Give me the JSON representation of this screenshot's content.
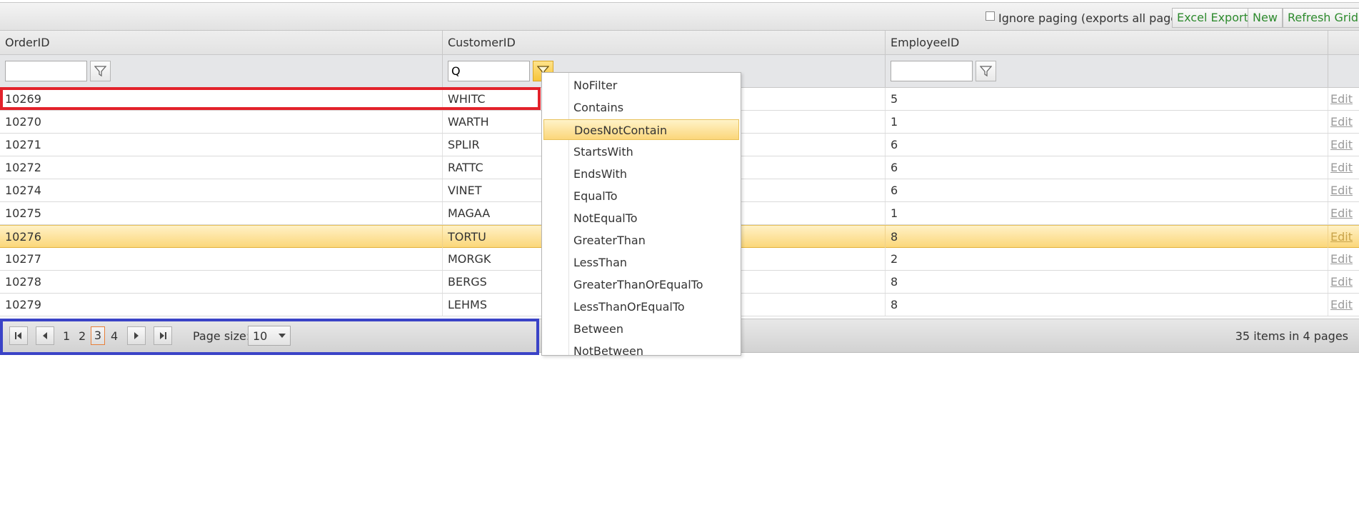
{
  "toolbar": {
    "ignore_paging_label": "Ignore paging (exports all pages)",
    "ignore_paging_checked": false,
    "excel_export": "Excel Export",
    "new": "New",
    "refresh_grid": "Refresh Grid",
    "button_text_color": "#2e8b2e"
  },
  "columns": [
    "OrderID",
    "CustomerID",
    "EmployeeID"
  ],
  "filters": {
    "order_id": "",
    "customer_id": "Q",
    "employee_id": ""
  },
  "rows": [
    {
      "order_id": "10269",
      "customer_id": "WHITC",
      "employee_id": "5",
      "edit": "Edit"
    },
    {
      "order_id": "10270",
      "customer_id": "WARTH",
      "employee_id": "1",
      "edit": "Edit"
    },
    {
      "order_id": "10271",
      "customer_id": "SPLIR",
      "employee_id": "6",
      "edit": "Edit"
    },
    {
      "order_id": "10272",
      "customer_id": "RATTC",
      "employee_id": "6",
      "edit": "Edit"
    },
    {
      "order_id": "10274",
      "customer_id": "VINET",
      "employee_id": "6",
      "edit": "Edit"
    },
    {
      "order_id": "10275",
      "customer_id": "MAGAA",
      "employee_id": "1",
      "edit": "Edit"
    },
    {
      "order_id": "10276",
      "customer_id": "TORTU",
      "employee_id": "8",
      "edit": "Edit",
      "selected": true
    },
    {
      "order_id": "10277",
      "customer_id": "MORGK",
      "employee_id": "2",
      "edit": "Edit"
    },
    {
      "order_id": "10278",
      "customer_id": "BERGS",
      "employee_id": "8",
      "edit": "Edit"
    },
    {
      "order_id": "10279",
      "customer_id": "LEHMS",
      "employee_id": "8",
      "edit": "Edit"
    }
  ],
  "pager": {
    "pages": [
      "1",
      "2",
      "3",
      "4"
    ],
    "current_page": "3",
    "page_size_label": "Page size:",
    "page_size": "10",
    "info": "35 items in 4 pages"
  },
  "filter_menu": {
    "highlighted": "DoesNotContain",
    "items": [
      "NoFilter",
      "Contains",
      "DoesNotContain",
      "StartsWith",
      "EndsWith",
      "EqualTo",
      "NotEqualTo",
      "GreaterThan",
      "LessThan",
      "GreaterThanOrEqualTo",
      "LessThanOrEqualTo",
      "Between",
      "NotBetween"
    ]
  },
  "colors": {
    "selection": "#fbd77a",
    "annotation_red": "#e3222b",
    "annotation_blue": "#3a43c7",
    "current_page_border": "#e8803a"
  }
}
